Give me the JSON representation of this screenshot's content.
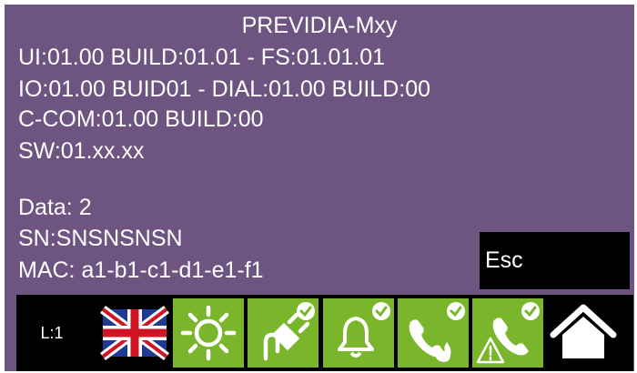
{
  "screen": {
    "title": "PREVIDIA-Mxy",
    "info_lines": [
      "UI:01.00 BUILD:01.01 - FS:01.01.01",
      "IO:01.00 BUID01 - DIAL:01.00 BUILD:00",
      "C-COM:01.00 BUILD:00",
      "SW:01.xx.xx",
      "Data: 2",
      "SN:SNSNSNSN",
      "MAC: a1-b1-c1-d1-e1-f1"
    ],
    "esc_label": "Esc",
    "background_color": "#6e5480"
  },
  "statusbar": {
    "level_label": "L:1",
    "items": [
      {
        "icon": "uk-flag-icon",
        "label": "language"
      },
      {
        "icon": "sun-icon",
        "label": "display"
      },
      {
        "icon": "power-plug-check-icon",
        "label": "power"
      },
      {
        "icon": "bell-check-icon",
        "label": "alarm"
      },
      {
        "icon": "phone-fire-check-icon",
        "label": "fire call"
      },
      {
        "icon": "phone-warning-check-icon",
        "label": "fault call"
      },
      {
        "icon": "home-icon",
        "label": "home"
      }
    ],
    "accent_green": "#7ab62b"
  }
}
